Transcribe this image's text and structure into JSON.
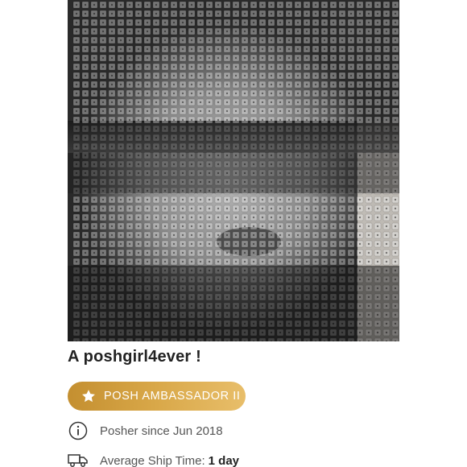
{
  "profile": {
    "username": "A poshgirl4ever !",
    "badge_label": "POSH AMBASSADOR II",
    "posher_since": "Posher since Jun 2018",
    "ship_time_label": "Average Ship Time:",
    "ship_time_value": "1 day"
  },
  "icons": {
    "badge": "star-icon",
    "info": "info-icon",
    "shipping": "truck-icon"
  },
  "colors": {
    "badge_gold_start": "#c48f30",
    "badge_gold_end": "#e8be6a",
    "text_primary": "#222222",
    "text_secondary": "#555555"
  }
}
